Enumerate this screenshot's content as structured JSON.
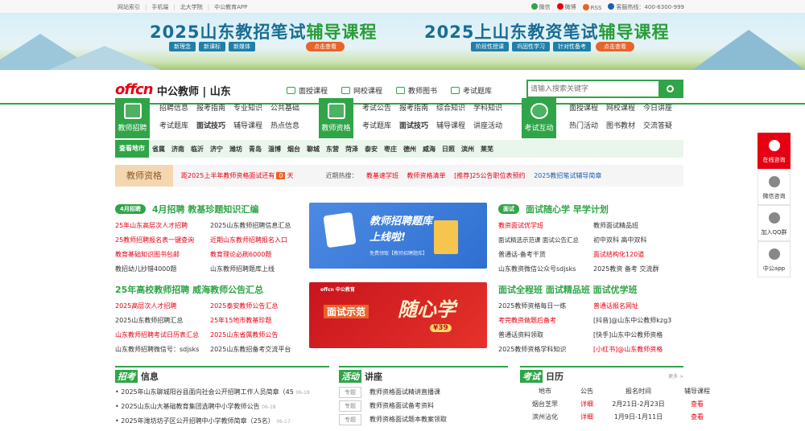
{
  "topbar": {
    "left": [
      "网站索引",
      "手机端",
      "北大学院",
      "中公教育APP"
    ],
    "right": [
      "微信",
      "微博",
      "RSS",
      "客服热线：400-6300-999"
    ]
  },
  "banner": {
    "left": {
      "title_a": "2025山东教招笔试",
      "title_b": "辅导课程",
      "subs": [
        "新理念",
        "新课标",
        "新媒体"
      ],
      "btn": "点击查看"
    },
    "right": {
      "title_a": "2025上山东教资笔试",
      "title_b": "辅导课程",
      "subs": [
        "阶段性授课",
        "巩固性学习",
        "针对性备考"
      ],
      "btn": "点击查看"
    }
  },
  "header": {
    "logo": "offcn",
    "brand": "中公教师 | 山东",
    "nav": [
      "面授课程",
      "网校课程",
      "教师图书",
      "考试题库"
    ],
    "search_placeholder": "请输入搜索关键字"
  },
  "nav": {
    "t1": {
      "label": "教师招聘",
      "r1": [
        "招聘信息",
        "报考指南",
        "专业知识",
        "公共基础"
      ],
      "r2": [
        "考试题库",
        "面试技巧",
        "辅导课程",
        "热点信息"
      ]
    },
    "t2": {
      "label": "教师资格",
      "r1": [
        "考试公告",
        "报考指南",
        "综合知识",
        "学科知识"
      ],
      "r2": [
        "考试题库",
        "面试技巧",
        "辅导课程",
        "讲座活动"
      ]
    },
    "t3": {
      "label": "考试互动",
      "r1": [
        "面授课程",
        "网校课程",
        "今日讲座"
      ],
      "r2": [
        "热门活动",
        "图书教材",
        "交流答疑"
      ]
    }
  },
  "cities": {
    "label": "查看地市",
    "items": [
      "省属",
      "济南",
      "临沂",
      "济宁",
      "潍坊",
      "青岛",
      "淄博",
      "烟台",
      "聊城",
      "东营",
      "菏泽",
      "泰安",
      "枣庄",
      "德州",
      "威海",
      "日照",
      "滨州",
      "莱芜"
    ]
  },
  "notice": {
    "label": "教师资格",
    "countdown_pre": "距2025上半年教师资格面试还有",
    "countdown_num": "0",
    "countdown_post": "天",
    "hot_label": "近期热搜：",
    "hot": [
      "教基速学班",
      "教师资格清单",
      "[推荐]25公告职位表预约",
      "2025教招笔试辅导简章"
    ]
  },
  "s1": {
    "tag": "4月招聘",
    "title": "4月招聘 教基珍题知识汇编",
    "items": [
      "25年山东高层次人才招聘",
      "2025山东教师招聘信息汇总",
      "25教师招聘报名表一键查询",
      "近期山东教师招聘报名入口",
      "教育基础知识图书包邮",
      "教育理论必刷6000题",
      "教招幼儿抄错4000题",
      "山东教师招聘题库上线"
    ]
  },
  "s2": {
    "title": "25年高校教师招聘 威海教师公告汇总",
    "items": [
      "2025高层次人才招聘",
      "2025泰安教师公告汇总",
      "2025山东教师招聘汇总",
      "25年15地市教基珍题",
      "山东教师招聘考试日历表汇总",
      "2025山东省属教师公告",
      "山东教师招聘微信号：sdjsks",
      "2025山东教招备考交流平台"
    ]
  },
  "s3": {
    "tag": "面试",
    "title": "面试随心学 早学计划",
    "items": [
      "教资面试优学班",
      "教师面试精品班",
      "面试精选示范课",
      "面试公告汇总",
      "初中双科",
      "高中双科",
      "普通话-备考干货",
      "面试结构化120道",
      "山东教资微信公众号sdjsks",
      "2025教资 备考 交流群"
    ]
  },
  "s4": {
    "title": "面试全程班 面试精品班 面试优学班",
    "items": [
      "2025教师资格每日一练",
      "普通话报名网址",
      "考完教资做题后备考",
      "[抖音]@山东中公教师kzg3",
      "普通话资料领取",
      "[快手]山东中公教师资格",
      "2025教师资格学科知识",
      "[小红书]@山东教师资格"
    ]
  },
  "ad1": {
    "title": "教师招聘题库",
    "sub": "上线啦!",
    "note": "免费领取【教师招聘题库】"
  },
  "ad2": {
    "brand": "offcn 中公教育",
    "title": "面试示范",
    "big": "随心学",
    "price": "¥39"
  },
  "side": [
    "在线咨询",
    "微信咨询",
    "加入QQ群",
    "中公app"
  ],
  "p1": {
    "l": "招考",
    "r": "信息",
    "items": [
      {
        "t": "2025年山东聊城阳谷县面向社会公开招聘工作人员简章（45",
        "d": "06-18"
      },
      {
        "t": "2025山东山大基础教育集团选聘中小学教师公告",
        "d": "06-18"
      },
      {
        "t": "2025年潍坊坊子区公开招聘中小学教师简章（25名）",
        "d": "06-17"
      }
    ]
  },
  "p2": {
    "l": "活动",
    "r": "讲座",
    "items": [
      {
        "tag": "专题",
        "t": "教师资格面试精讲直播课"
      },
      {
        "tag": "专题",
        "t": "教师资格面试备考资料"
      },
      {
        "tag": "专题",
        "t": "教师资格面试题本教案领取"
      }
    ]
  },
  "p3": {
    "l": "考试",
    "r": "日历",
    "more": "更多 >",
    "head": [
      "地市",
      "公告",
      "报名时间",
      "辅导课程"
    ],
    "rows": [
      [
        "烟台芝罘",
        "详细",
        "2月21日-2月23日",
        "查看"
      ],
      [
        "滨州沾化",
        "详细",
        "1月9日-1月11日",
        "查看"
      ]
    ]
  },
  "colors": {
    "green": "#2fa548",
    "red": "#e60012",
    "orange": "#e8642a"
  }
}
